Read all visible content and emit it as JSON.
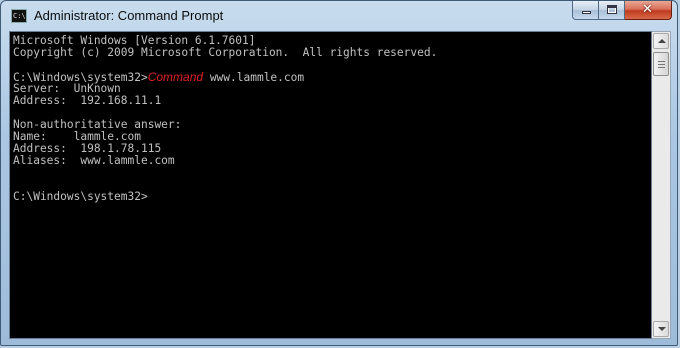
{
  "window": {
    "title": "Administrator: Command Prompt",
    "controls": {
      "minimize": "minimize",
      "maximize": "maximize",
      "close": "✕"
    }
  },
  "console": {
    "lines": [
      {
        "text": "Microsoft Windows [Version 6.1.7601]"
      },
      {
        "text": "Copyright (c) 2009 Microsoft Corporation.  All rights reserved."
      },
      {
        "text": ""
      },
      {
        "prompt": "C:\\Windows\\system32>",
        "command": "Command",
        "args": " www.lammle.com"
      },
      {
        "text": "Server:  UnKnown"
      },
      {
        "text": "Address:  192.168.11.1"
      },
      {
        "text": ""
      },
      {
        "text": "Non-authoritative answer:"
      },
      {
        "text": "Name:    lammle.com"
      },
      {
        "text": "Address:  198.1.78.115"
      },
      {
        "text": "Aliases:  www.lammle.com"
      },
      {
        "text": ""
      },
      {
        "text": ""
      },
      {
        "prompt": "C:\\Windows\\system32>"
      }
    ]
  },
  "colors": {
    "console_bg": "#000000",
    "console_text": "#c0c0c0",
    "command_text": "#e02020"
  }
}
